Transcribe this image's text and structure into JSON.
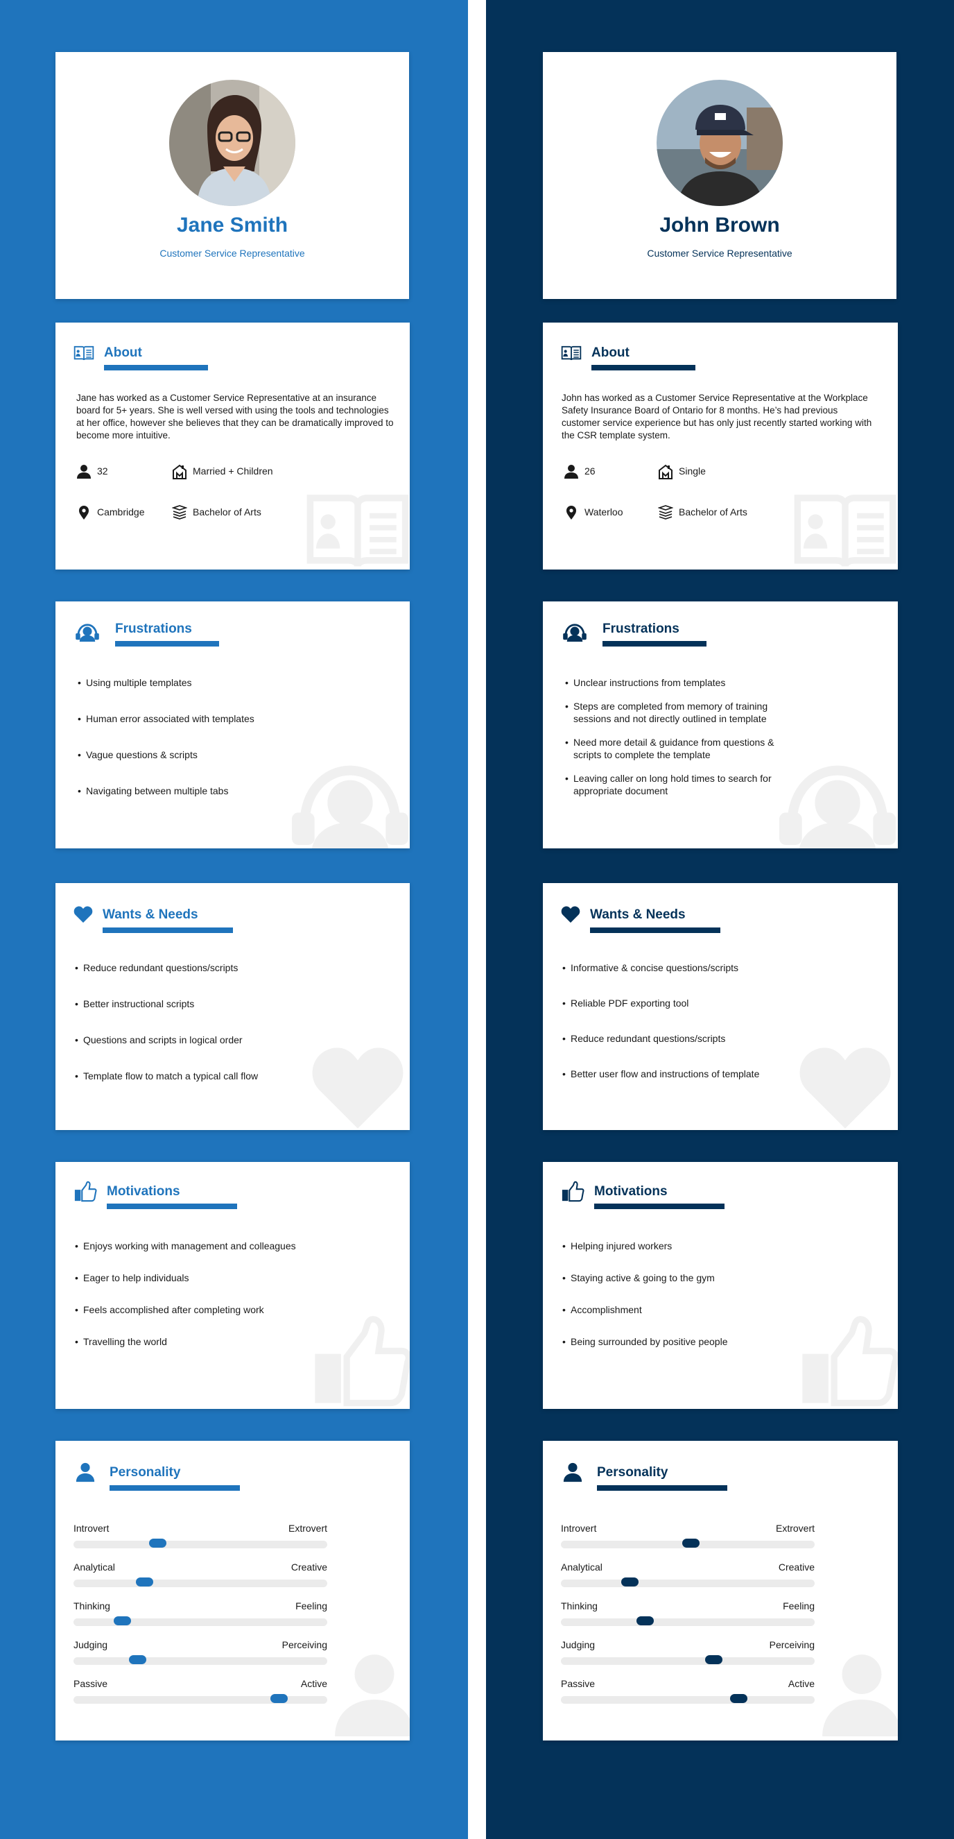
{
  "colors": {
    "left_accent": "#1f74bc",
    "right_accent": "#043259",
    "watermark": "#f0f0f0"
  },
  "left": {
    "profile": {
      "name": "Jane Smith",
      "role": "Customer Service Representative",
      "photo": "portrait-woman-glasses"
    },
    "about": {
      "title": "About",
      "text": "Jane has worked as a Customer Service Representative at an insurance board for 5+ years. She is well versed with using the tools and technologies at her office, however she believes that they can be dramatically improved to become more intuitive.",
      "age": "32",
      "status": "Married + Children",
      "location": "Cambridge",
      "education": "Bachelor of Arts"
    },
    "frustrations": {
      "title": "Frustrations",
      "items": [
        "Using multiple templates",
        "Human error associated with templates",
        "Vague questions & scripts",
        "Navigating between multiple tabs"
      ]
    },
    "wants": {
      "title": "Wants & Needs",
      "items": [
        "Reduce redundant questions/scripts",
        "Better instructional scripts",
        "Questions and scripts in logical order",
        "Template flow to match a typical call flow"
      ]
    },
    "motivations": {
      "title": "Motivations",
      "items": [
        "Enjoys working with management and colleagues",
        "Eager to help individuals",
        "Feels accomplished after completing work",
        " Travelling the world"
      ]
    },
    "personality": {
      "title": "Personality",
      "traits": [
        {
          "left": "Introvert",
          "right": "Extrovert",
          "value": 0.33
        },
        {
          "left": "Analytical",
          "right": "Creative",
          "value": 0.28
        },
        {
          "left": "Thinking",
          "right": "Feeling",
          "value": 0.19
        },
        {
          "left": "Judging",
          "right": "Perceiving",
          "value": 0.25
        },
        {
          "left": "Passive",
          "right": "Active",
          "value": 0.81
        }
      ]
    }
  },
  "right": {
    "profile": {
      "name": "John Brown",
      "role": "Customer Service Representative",
      "photo": "portrait-man-cap"
    },
    "about": {
      "title": "About",
      "text": "John has worked as a Customer Service Representative at the Workplace Safety Insurance Board of Ontario for 8 months. He’s had previous customer service experience but has only just recently started working with the CSR template system.",
      "age": "26",
      "status": "Single",
      "location": "Waterloo",
      "education": "Bachelor of Arts"
    },
    "frustrations": {
      "title": "Frustrations",
      "items": [
        "Unclear instructions from templates",
        "Steps are completed from memory of training sessions and not directly outlined in template",
        "Need more detail & guidance from questions & scripts to complete the template",
        "Leaving caller on long hold times to search for appropriate document"
      ]
    },
    "wants": {
      "title": "Wants & Needs",
      "items": [
        "Informative & concise questions/scripts",
        "Reliable PDF exporting tool",
        "Reduce redundant questions/scripts",
        "Better user flow and instructions of template"
      ]
    },
    "motivations": {
      "title": "Motivations",
      "items": [
        "Helping injured workers",
        "Staying active & going to the gym",
        "Accomplishment",
        "Being surrounded by positive people"
      ]
    },
    "personality": {
      "title": "Personality",
      "traits": [
        {
          "left": "Introvert",
          "right": "Extrovert",
          "value": 0.51
        },
        {
          "left": "Analytical",
          "right": "Creative",
          "value": 0.27
        },
        {
          "left": "Thinking",
          "right": "Feeling",
          "value": 0.33
        },
        {
          "left": "Judging",
          "right": "Perceiving",
          "value": 0.6
        },
        {
          "left": "Passive",
          "right": "Active",
          "value": 0.7
        }
      ]
    }
  }
}
